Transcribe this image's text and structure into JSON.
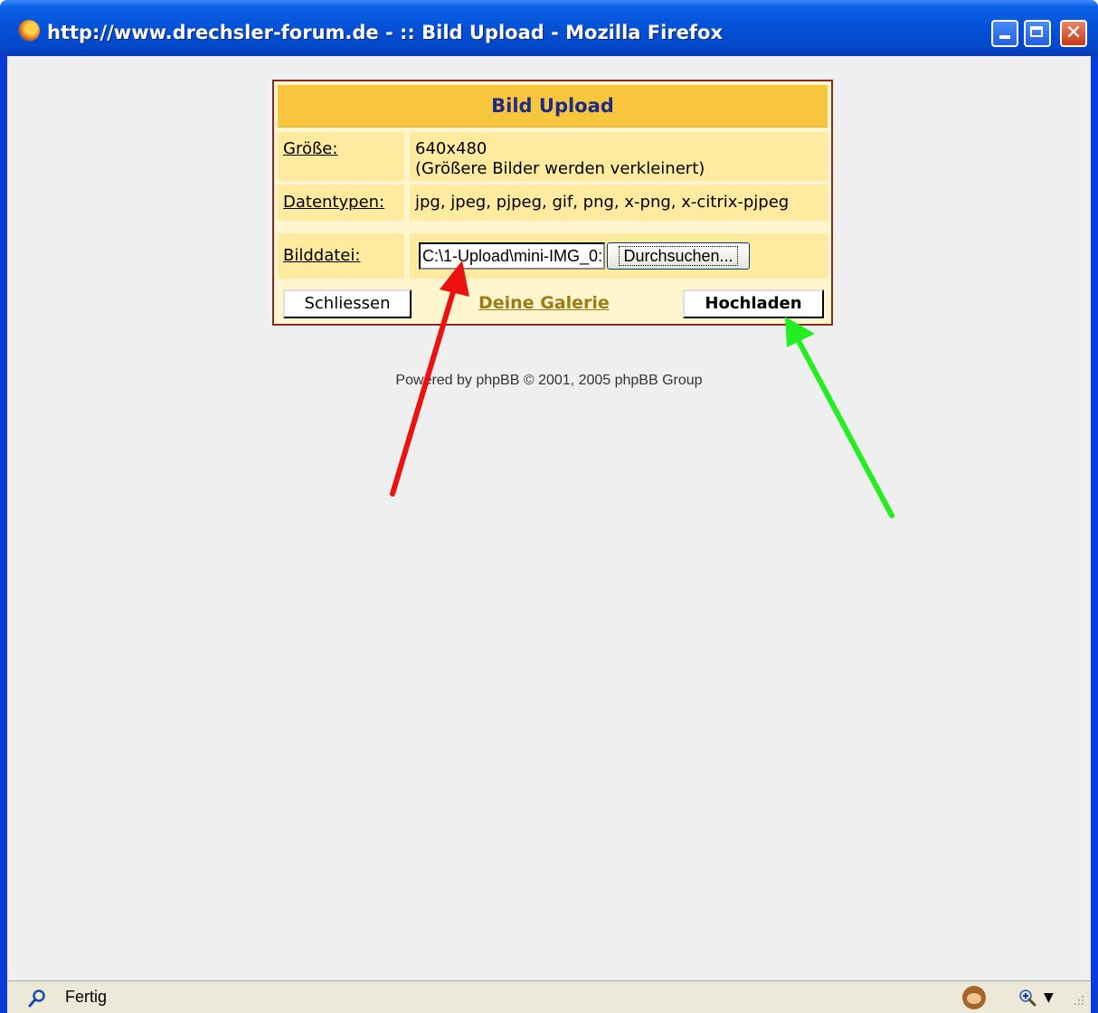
{
  "window": {
    "title": "http://www.drechsler-forum.de - :: Bild Upload - Mozilla Firefox",
    "minimize_glyph": "",
    "maximize_glyph": "",
    "close_glyph": "✕"
  },
  "panel": {
    "title": "Bild Upload",
    "rows": [
      {
        "label": "Größe:",
        "value_line1": "640x480",
        "value_line2": "(Größere Bilder werden verkleinert)"
      },
      {
        "label": "Datentypen:",
        "value": "jpg, jpeg, pjpeg, gif, png, x-png, x-citrix-pjpeg"
      },
      {
        "label": "Bilddatei:"
      }
    ],
    "file_input_value": "C:\\1-Upload\\mini-IMG_0:",
    "browse_label": "Durchsuchen...",
    "close_label": "Schliessen",
    "gallery_link": "Deine Galerie",
    "upload_label": "Hochladen"
  },
  "footer": {
    "powered": "Powered by phpBB © 2001, 2005 phpBB Group"
  },
  "statusbar": {
    "text": "Fertig"
  },
  "annotation_colors": {
    "red_arrow": "#ee1111",
    "green_arrow": "#22ee22"
  }
}
